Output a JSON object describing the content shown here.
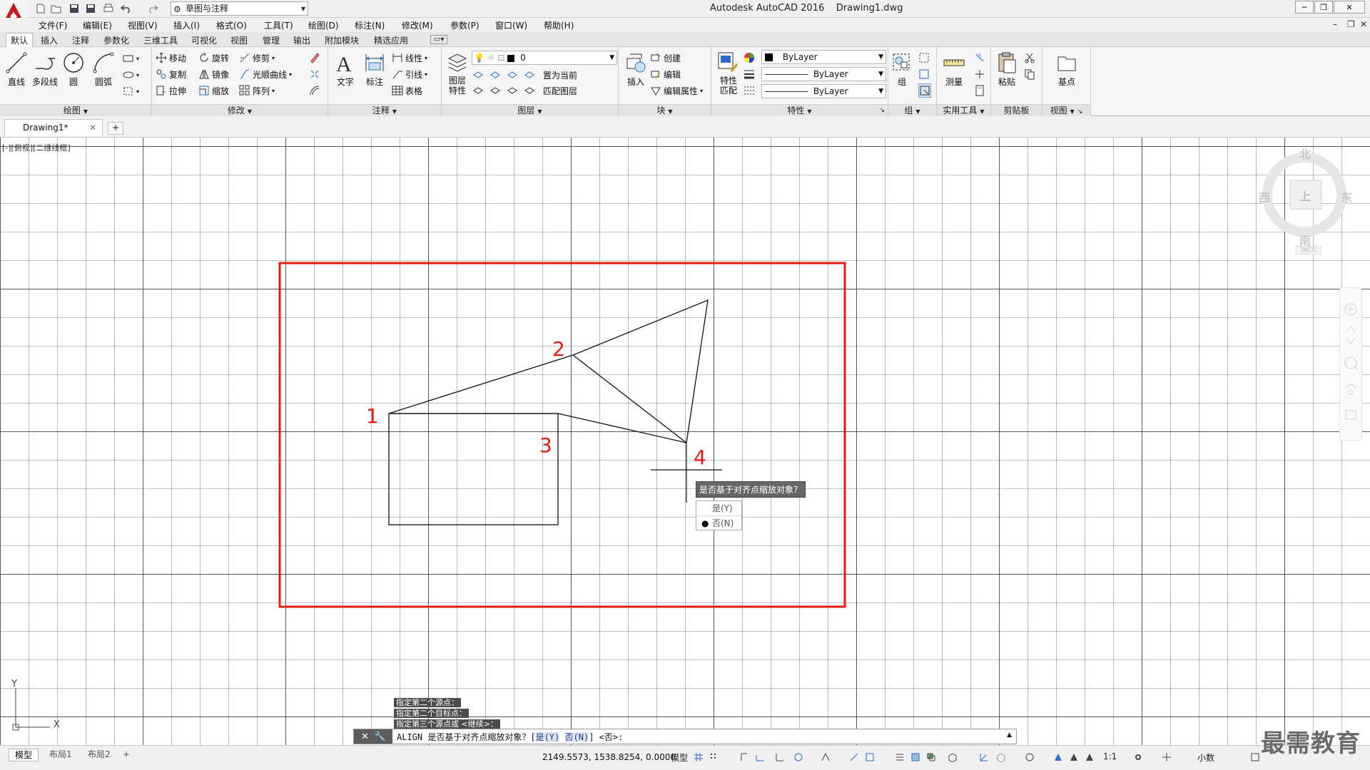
{
  "titlebar": {
    "workspace": "草图与注释",
    "app_name": "Autodesk AutoCAD 2016",
    "drawing_name": "Drawing1.dwg"
  },
  "menu": [
    "文件(F)",
    "编辑(E)",
    "视图(V)",
    "插入(I)",
    "格式(O)",
    "工具(T)",
    "绘图(D)",
    "标注(N)",
    "修改(M)",
    "参数(P)",
    "窗口(W)",
    "帮助(H)"
  ],
  "ribbon_tabs": [
    "默认",
    "插入",
    "注释",
    "参数化",
    "三维工具",
    "可视化",
    "视图",
    "管理",
    "输出",
    "附加模块",
    "精选应用"
  ],
  "ribbon": {
    "draw": {
      "title": "绘图",
      "line": "直线",
      "polyline": "多段线",
      "circle": "圆",
      "arc": "圆弧"
    },
    "modify": {
      "title": "修改",
      "move": "移动",
      "rotate": "旋转",
      "trim": "修剪",
      "copy": "复制",
      "mirror": "镜像",
      "fillet": "光顺曲线",
      "stretch": "拉伸",
      "scale": "缩放",
      "array": "阵列"
    },
    "annotation": {
      "title": "注释",
      "text": "文字",
      "dimension": "标注",
      "linear": "线性",
      "leader": "引线",
      "table": "表格"
    },
    "layers": {
      "title": "图层",
      "layer_props": "图层\n特性",
      "current_layer": "0",
      "set_current": "置为当前",
      "match_layer": "匹配图层"
    },
    "block": {
      "title": "块",
      "insert": "插入",
      "create": "创建",
      "edit": "编辑",
      "edit_attr": "编辑属性"
    },
    "properties": {
      "title": "特性",
      "match": "特性\n匹配",
      "color": "ByLayer",
      "linetype": "ByLayer",
      "lineweight": "ByLayer"
    },
    "groups": {
      "title": "组",
      "group": "组"
    },
    "utilities": {
      "title": "实用工具",
      "measure": "测量"
    },
    "clipboard": {
      "title": "剪贴板",
      "paste": "粘贴"
    },
    "view": {
      "title": "视图",
      "base": "基点"
    }
  },
  "doc_tab": {
    "name": "Drawing1*"
  },
  "canvas": {
    "viewport_label": "[-][俯视][二维线框]",
    "viewcube": {
      "north": "北",
      "south": "南",
      "east": "东",
      "west": "西",
      "face": "上",
      "wcs": "WCS"
    },
    "ucs": {
      "y": "Y",
      "x": "X"
    },
    "point_labels": [
      "1",
      "2",
      "3",
      "4"
    ],
    "tooltip": "是否基于对齐点缩放对象？",
    "options": [
      {
        "label": "是(Y)",
        "selected": false
      },
      {
        "label": "否(N)",
        "selected": true
      }
    ],
    "history": [
      "指定第二个源点：",
      "指定第二个目标点：",
      "指定第三个源点或 <继续>："
    ],
    "command": {
      "prefix": "ALIGN 是否基于对齐点缩放对象？[",
      "opt_yes": "是(Y)",
      "opt_no": "否(N)",
      "suffix": "] <否>:"
    }
  },
  "status": {
    "layout_tabs": [
      "模型",
      "布局1",
      "布局2"
    ],
    "coords": "2149.5573, 1538.8254, 0.0000",
    "space": "模型",
    "scale": "1:1",
    "units": "小数"
  },
  "watermark": "最需教育",
  "colors": {
    "highlight": "#e8190f",
    "ribbon_bg": "#f5f5f5",
    "grid": "#3a3a3a"
  }
}
